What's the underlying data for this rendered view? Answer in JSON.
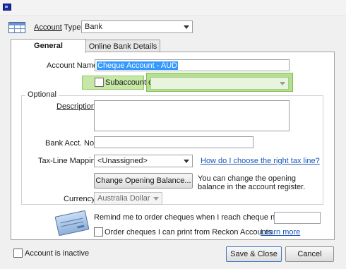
{
  "header": {
    "account_type_label": "Account Type",
    "account_type_value": "Bank"
  },
  "tabs": [
    {
      "label": "General",
      "active": true
    },
    {
      "label": "Online Bank Details",
      "active": false
    }
  ],
  "general": {
    "account_name_label": "Account Name",
    "account_name_value": "Cheque Account - AUD",
    "subaccount_label": "Subaccount of",
    "subaccount_checked": false,
    "subaccount_value": "",
    "optional_label": "Optional",
    "description_label": "Description",
    "description_value": "",
    "bank_acct_label": "Bank Acct. No.",
    "bank_acct_value": "",
    "tax_line_label": "Tax-Line Mapping",
    "tax_line_value": "<Unassigned>",
    "tax_line_help_link": "How do I choose the right tax line?",
    "opening_balance_button": "Change Opening Balance...",
    "opening_balance_note": "You can change the opening balance in the account register.",
    "currency_label": "Currency",
    "currency_value": "Australia Dollar",
    "remind_label": "Remind me to order cheques when I reach cheque number",
    "remind_value": "",
    "order_cheques_label": "Order cheques I can print from Reckon Accounts",
    "order_cheques_checked": false,
    "learn_more_link": "Learn more"
  },
  "footer": {
    "inactive_label": "Account is inactive",
    "inactive_checked": false,
    "save_close_button": "Save & Close",
    "cancel_button": "Cancel"
  },
  "colors": {
    "highlight_green": "#b6df92",
    "link_blue": "#1a55b8",
    "selection_blue": "#3399ff"
  },
  "icons": {
    "window": "app-window-icon",
    "account_type": "account-register-icon",
    "cheque": "cheque-icon"
  }
}
